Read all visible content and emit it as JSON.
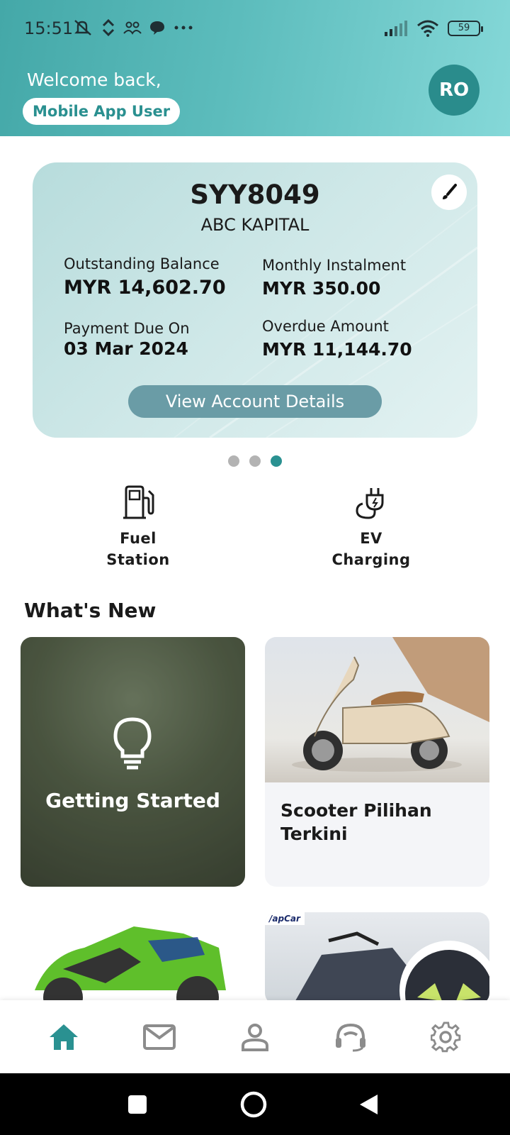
{
  "status_bar": {
    "time": "15:51",
    "battery": "59"
  },
  "header": {
    "welcome": "Welcome back,",
    "user_name": "Mobile App User",
    "avatar_initials": "RO"
  },
  "account_card": {
    "plate": "SYY8049",
    "bank": "ABC KAPITAL",
    "outstanding_label": "Outstanding Balance",
    "outstanding_value": "MYR 14,602.70",
    "monthly_label": "Monthly Instalment",
    "monthly_value": "MYR 350.00",
    "due_label": "Payment Due On",
    "due_value": "03 Mar 2024",
    "overdue_label": "Overdue Amount",
    "overdue_value": "MYR 11,144.70",
    "view_button": "View Account Details"
  },
  "carousel": {
    "count": 3,
    "active_index": 2
  },
  "quick_actions": [
    {
      "label": "Fuel\nStation",
      "icon": "fuel-pump-icon"
    },
    {
      "label": "EV\nCharging",
      "icon": "ev-charging-icon"
    }
  ],
  "whats_new": {
    "title": "What's New",
    "cards": [
      {
        "title": "Getting Started",
        "icon": "lightbulb-icon"
      },
      {
        "title": "Scooter Pilihan Terkini"
      },
      {
        "title": ""
      },
      {
        "tag": "/apCar"
      }
    ]
  },
  "bottom_nav": [
    {
      "name": "home",
      "icon": "home-icon",
      "active": true
    },
    {
      "name": "inbox",
      "icon": "mail-icon",
      "active": false
    },
    {
      "name": "profile",
      "icon": "person-icon",
      "active": false
    },
    {
      "name": "support",
      "icon": "headset-icon",
      "active": false
    },
    {
      "name": "settings",
      "icon": "gear-icon",
      "active": false
    }
  ],
  "colors": {
    "primary": "#2a9191",
    "header_start": "#44a8a8",
    "header_end": "#85d8d8",
    "button": "#6a9ca6",
    "inactive_icon": "#8c8c8c"
  }
}
